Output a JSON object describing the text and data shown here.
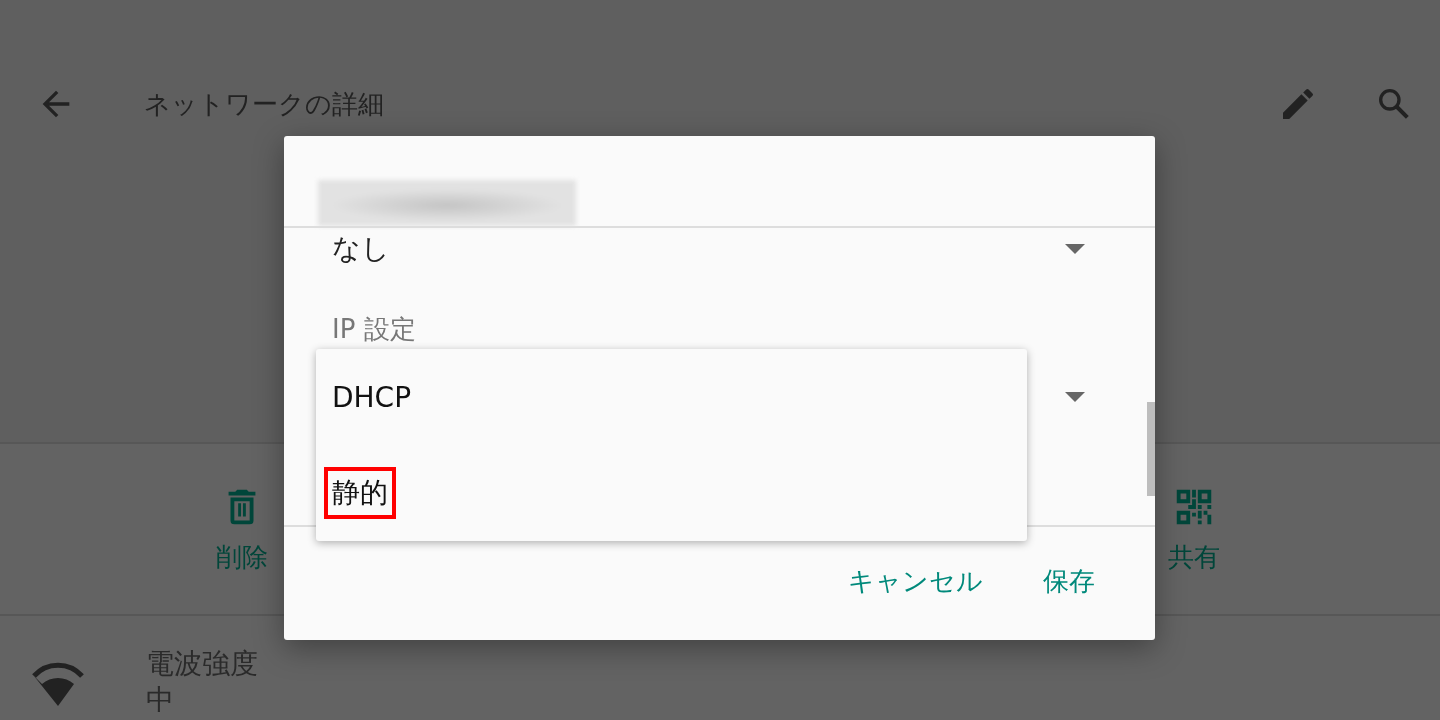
{
  "app_bar": {
    "title": "ネットワークの詳細"
  },
  "actions": [
    {
      "label": "削除",
      "kind": "delete"
    },
    {
      "label": "共有",
      "kind": "share"
    }
  ],
  "details": [
    {
      "title": "電波強度",
      "value": "中"
    }
  ],
  "dialog": {
    "security_select": {
      "value": "なし"
    },
    "ip_settings": {
      "label": "IP 設定"
    },
    "menu": [
      {
        "label": "DHCP",
        "highlighted": false
      },
      {
        "label": "静的",
        "highlighted": true
      }
    ],
    "buttons": [
      {
        "label": "キャンセル"
      },
      {
        "label": "保存"
      }
    ]
  }
}
